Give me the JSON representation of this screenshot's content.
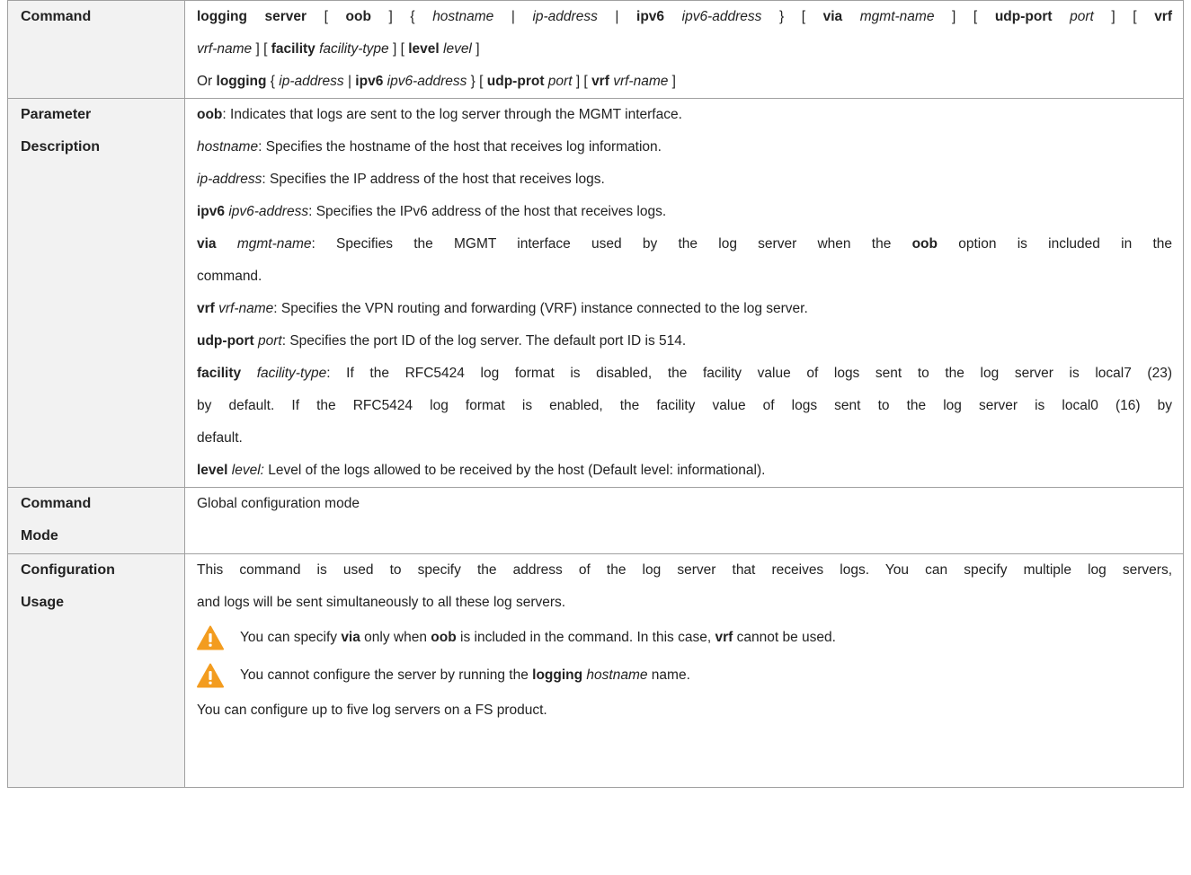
{
  "rows": {
    "command": {
      "label": "Command",
      "lines": [
        [
          [
            "b",
            "logging server"
          ],
          [
            "t",
            " [ "
          ],
          [
            "b",
            "oob"
          ],
          [
            "t",
            " ] { "
          ],
          [
            "i",
            "hostname"
          ],
          [
            "t",
            " | "
          ],
          [
            "i",
            "ip-address"
          ],
          [
            "t",
            " | "
          ],
          [
            "b",
            "ipv6"
          ],
          [
            "t",
            " "
          ],
          [
            "i",
            "ipv6-address"
          ],
          [
            "t",
            " } [ "
          ],
          [
            "b",
            "via"
          ],
          [
            "t",
            " "
          ],
          [
            "i",
            "mgmt-name"
          ],
          [
            "t",
            " ] [ "
          ],
          [
            "b",
            "udp-port"
          ],
          [
            "t",
            " "
          ],
          [
            "i",
            "port"
          ],
          [
            "t",
            " ] [ "
          ],
          [
            "b",
            "vrf"
          ]
        ],
        [
          [
            "i",
            "vrf-name"
          ],
          [
            "t",
            " ] [ "
          ],
          [
            "b",
            "facility"
          ],
          [
            "t",
            " "
          ],
          [
            "i",
            "facility-type"
          ],
          [
            "t",
            " ] [ "
          ],
          [
            "b",
            "level"
          ],
          [
            "t",
            " "
          ],
          [
            "i",
            "level"
          ],
          [
            "t",
            " ]"
          ]
        ],
        [
          [
            "t",
            "Or "
          ],
          [
            "b",
            "logging"
          ],
          [
            "t",
            " { "
          ],
          [
            "i",
            "ip-address"
          ],
          [
            "t",
            " | "
          ],
          [
            "b",
            "ipv6"
          ],
          [
            "t",
            " "
          ],
          [
            "i",
            "ipv6-address"
          ],
          [
            "t",
            " } [ "
          ],
          [
            "b",
            "udp-prot"
          ],
          [
            "t",
            " "
          ],
          [
            "i",
            "port"
          ],
          [
            "t",
            " ] [ "
          ],
          [
            "b",
            "vrf"
          ],
          [
            "t",
            " "
          ],
          [
            "i",
            "vrf-name"
          ],
          [
            "t",
            " ]"
          ]
        ]
      ]
    },
    "parameter": {
      "label_line1": "Parameter",
      "label_line2": "Description",
      "lines": [
        [
          [
            "b",
            "oob"
          ],
          [
            "t",
            ": Indicates that logs are sent to the log server through the MGMT interface."
          ]
        ],
        [
          [
            "i",
            "hostname"
          ],
          [
            "t",
            ": Specifies the hostname of the host that receives log information."
          ]
        ],
        [
          [
            "i",
            "ip-address"
          ],
          [
            "t",
            ": Specifies the IP address of the host that receives logs."
          ]
        ],
        [
          [
            "b",
            "ipv6"
          ],
          [
            "t",
            " "
          ],
          [
            "i",
            "ipv6-address"
          ],
          [
            "t",
            ": Specifies the IPv6 address of the host that receives logs."
          ]
        ],
        [
          [
            "b",
            "via"
          ],
          [
            "t",
            " "
          ],
          [
            "i",
            "mgmt-name"
          ],
          [
            "t",
            ": Specifies the MGMT interface used by the log server when the "
          ],
          [
            "b",
            "oob"
          ],
          [
            "t",
            " option is included in the"
          ]
        ],
        [
          [
            "t",
            "command."
          ]
        ],
        [
          [
            "b",
            "vrf"
          ],
          [
            "t",
            " "
          ],
          [
            "i",
            "vrf-name"
          ],
          [
            "t",
            ": Specifies the VPN routing and forwarding (VRF) instance connected to the log server."
          ]
        ],
        [
          [
            "b",
            "udp-port"
          ],
          [
            "t",
            " "
          ],
          [
            "i",
            "port"
          ],
          [
            "t",
            ": Specifies the port ID of the log server. The default port ID is 514."
          ]
        ],
        [
          [
            "b",
            "facility"
          ],
          [
            "t",
            " "
          ],
          [
            "i",
            "facility-type"
          ],
          [
            "t",
            ": If the RFC5424 log format is disabled, the facility value of logs sent to the log server is local7 (23)"
          ]
        ],
        [
          [
            "t",
            "by default. If the RFC5424 log format is enabled, the facility value of logs sent to the log server is local0 (16) by"
          ]
        ],
        [
          [
            "t",
            "default."
          ]
        ],
        [
          [
            "b",
            "level"
          ],
          [
            "t",
            " "
          ],
          [
            "i",
            "level:"
          ],
          [
            "t",
            " Level of the logs allowed to be received by the host (Default level: informational)."
          ]
        ]
      ]
    },
    "mode": {
      "label_line1": "Command",
      "label_line2": "Mode",
      "text": "Global configuration mode"
    },
    "usage": {
      "label_line1": "Configuration",
      "label_line2": "Usage",
      "lines": [
        [
          [
            "t",
            "This command is used to specify the address of the log server that receives logs. You can specify multiple log servers,"
          ]
        ],
        [
          [
            "t",
            "and logs will be sent simultaneously to all these log servers."
          ]
        ]
      ],
      "warnings": [
        [
          [
            "t",
            "You can specify "
          ],
          [
            "b",
            "via"
          ],
          [
            "t",
            " only when "
          ],
          [
            "b",
            "oob"
          ],
          [
            "t",
            " is included in the command. In this case, "
          ],
          [
            "b",
            "vrf"
          ],
          [
            "t",
            " cannot be used."
          ]
        ],
        [
          [
            "t",
            "You cannot configure the server by running the "
          ],
          [
            "b",
            "logging"
          ],
          [
            "t",
            " "
          ],
          [
            "i",
            "hostname"
          ],
          [
            "t",
            " name."
          ]
        ]
      ],
      "last_line": "You can configure up to five log servers on a FS product."
    }
  },
  "colors": {
    "warning_fill": "#f39c1f",
    "warning_mark": "#ffffff",
    "label_bg": "#f2f2f2",
    "border": "#a0a0a0"
  },
  "icons": [
    "warning-icon"
  ]
}
